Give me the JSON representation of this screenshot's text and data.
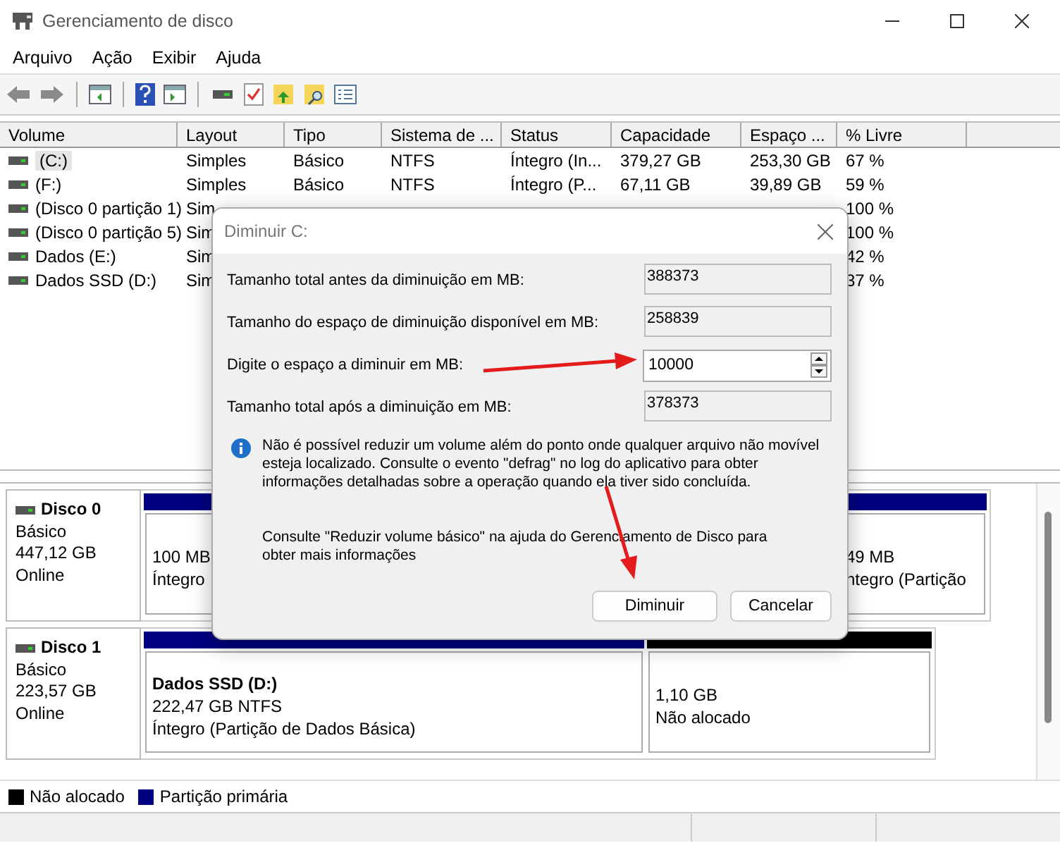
{
  "window": {
    "title": "Gerenciamento de disco"
  },
  "menu": [
    "Arquivo",
    "Ação",
    "Exibir",
    "Ajuda"
  ],
  "table": {
    "columns": [
      "Volume",
      "Layout",
      "Tipo",
      "Sistema de ...",
      "Status",
      "Capacidade",
      "Espaço ...",
      "% Livre"
    ],
    "rows": [
      {
        "volume": "(C:)",
        "layout": "Simples",
        "tipo": "Básico",
        "sistema": "NTFS",
        "status": "Íntegro (In...",
        "capacidade": "379,27 GB",
        "espaco": "253,30 GB",
        "livre": "67 %",
        "selected": true
      },
      {
        "volume": "(F:)",
        "layout": "Simples",
        "tipo": "Básico",
        "sistema": "NTFS",
        "status": "Íntegro (P...",
        "capacidade": "67,11 GB",
        "espaco": "39,89 GB",
        "livre": "59 %",
        "selected": false
      },
      {
        "volume": "(Disco 0 partição 1)",
        "layout": "Sim",
        "livre": "100 %",
        "selected": false
      },
      {
        "volume": "(Disco 0 partição 5)",
        "layout": "Sim",
        "livre": "100 %",
        "selected": false
      },
      {
        "volume": "Dados (E:)",
        "layout": "Sim",
        "livre": "42 %",
        "selected": false
      },
      {
        "volume": "Dados SSD (D:)",
        "layout": "Sim",
        "livre": "37 %",
        "selected": false
      }
    ]
  },
  "disks": [
    {
      "name": "Disco 0",
      "type": "Básico",
      "size": "447,12 GB",
      "status": "Online",
      "partitions": [
        {
          "color": "#000080",
          "lines": [
            "100 MB",
            "Íntegro"
          ]
        },
        {
          "color": "#000080",
          "lines": [
            "49 MB",
            "ntegro (Partição"
          ]
        }
      ]
    },
    {
      "name": "Disco 1",
      "type": "Básico",
      "size": "223,57 GB",
      "status": "Online",
      "partitions": [
        {
          "color": "#000080",
          "name": "Dados SSD  (D:)",
          "lines": [
            "222,47 GB NTFS",
            "Íntegro (Partição de Dados Básica)"
          ]
        },
        {
          "color": "#000000",
          "lines": [
            "1,10 GB",
            "Não alocado"
          ]
        }
      ]
    }
  ],
  "legend": [
    {
      "label": "Não alocado",
      "color": "#000000"
    },
    {
      "label": "Partição primária",
      "color": "#000080"
    }
  ],
  "dialog": {
    "title": "Diminuir C:",
    "fields": [
      {
        "kind": "readonly",
        "label": "Tamanho total antes da diminuição em MB:",
        "value": "388373"
      },
      {
        "kind": "readonly",
        "label": "Tamanho do espaço de diminuição disponível em MB:",
        "value": "258839"
      },
      {
        "kind": "spin",
        "label": "Digite o espaço a diminuir em MB:",
        "value": "10000"
      },
      {
        "kind": "readonly",
        "label": "Tamanho total após a diminuição em MB:",
        "value": "378373"
      }
    ],
    "info": "Não é possível reduzir um volume além do ponto onde qualquer arquivo não movível esteja localizado. Consulte o evento \"defrag\" no log do aplicativo para obter informações detalhadas sobre a operação quando ela tiver sido concluída.",
    "help": "Consulte \"Reduzir volume básico\" na ajuda do Gerenciamento de Disco para obter mais informações",
    "buttons": [
      "Diminuir",
      "Cancelar"
    ]
  }
}
